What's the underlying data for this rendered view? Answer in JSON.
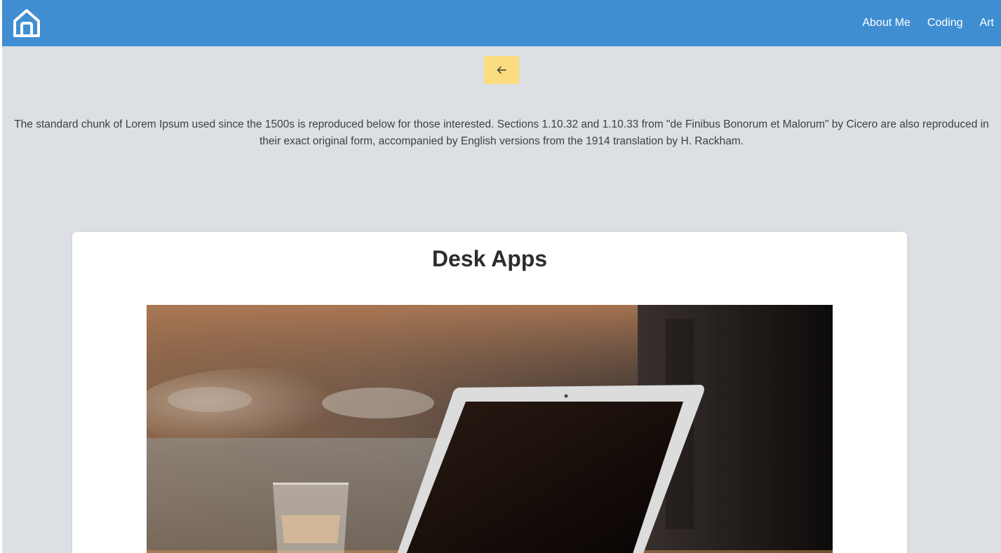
{
  "navbar": {
    "home_icon": "home-icon",
    "links": [
      "About Me",
      "Coding",
      "Art"
    ],
    "background": "#3f8ed2"
  },
  "back_button": {
    "icon": "arrow-left-icon",
    "color": "#fbdc7e"
  },
  "intro": {
    "text": "The standard chunk of Lorem Ipsum used since the 1500s is reproduced below for those interested. Sections 1.10.32 and 1.10.33 from \"de Finibus Bonorum et Malorum\" by Cicero are also reproduced in their exact original form, accompanied by English versions from the 1914 translation by H. Rackham."
  },
  "card": {
    "title": "Desk Apps",
    "image": "laptop-photo"
  }
}
